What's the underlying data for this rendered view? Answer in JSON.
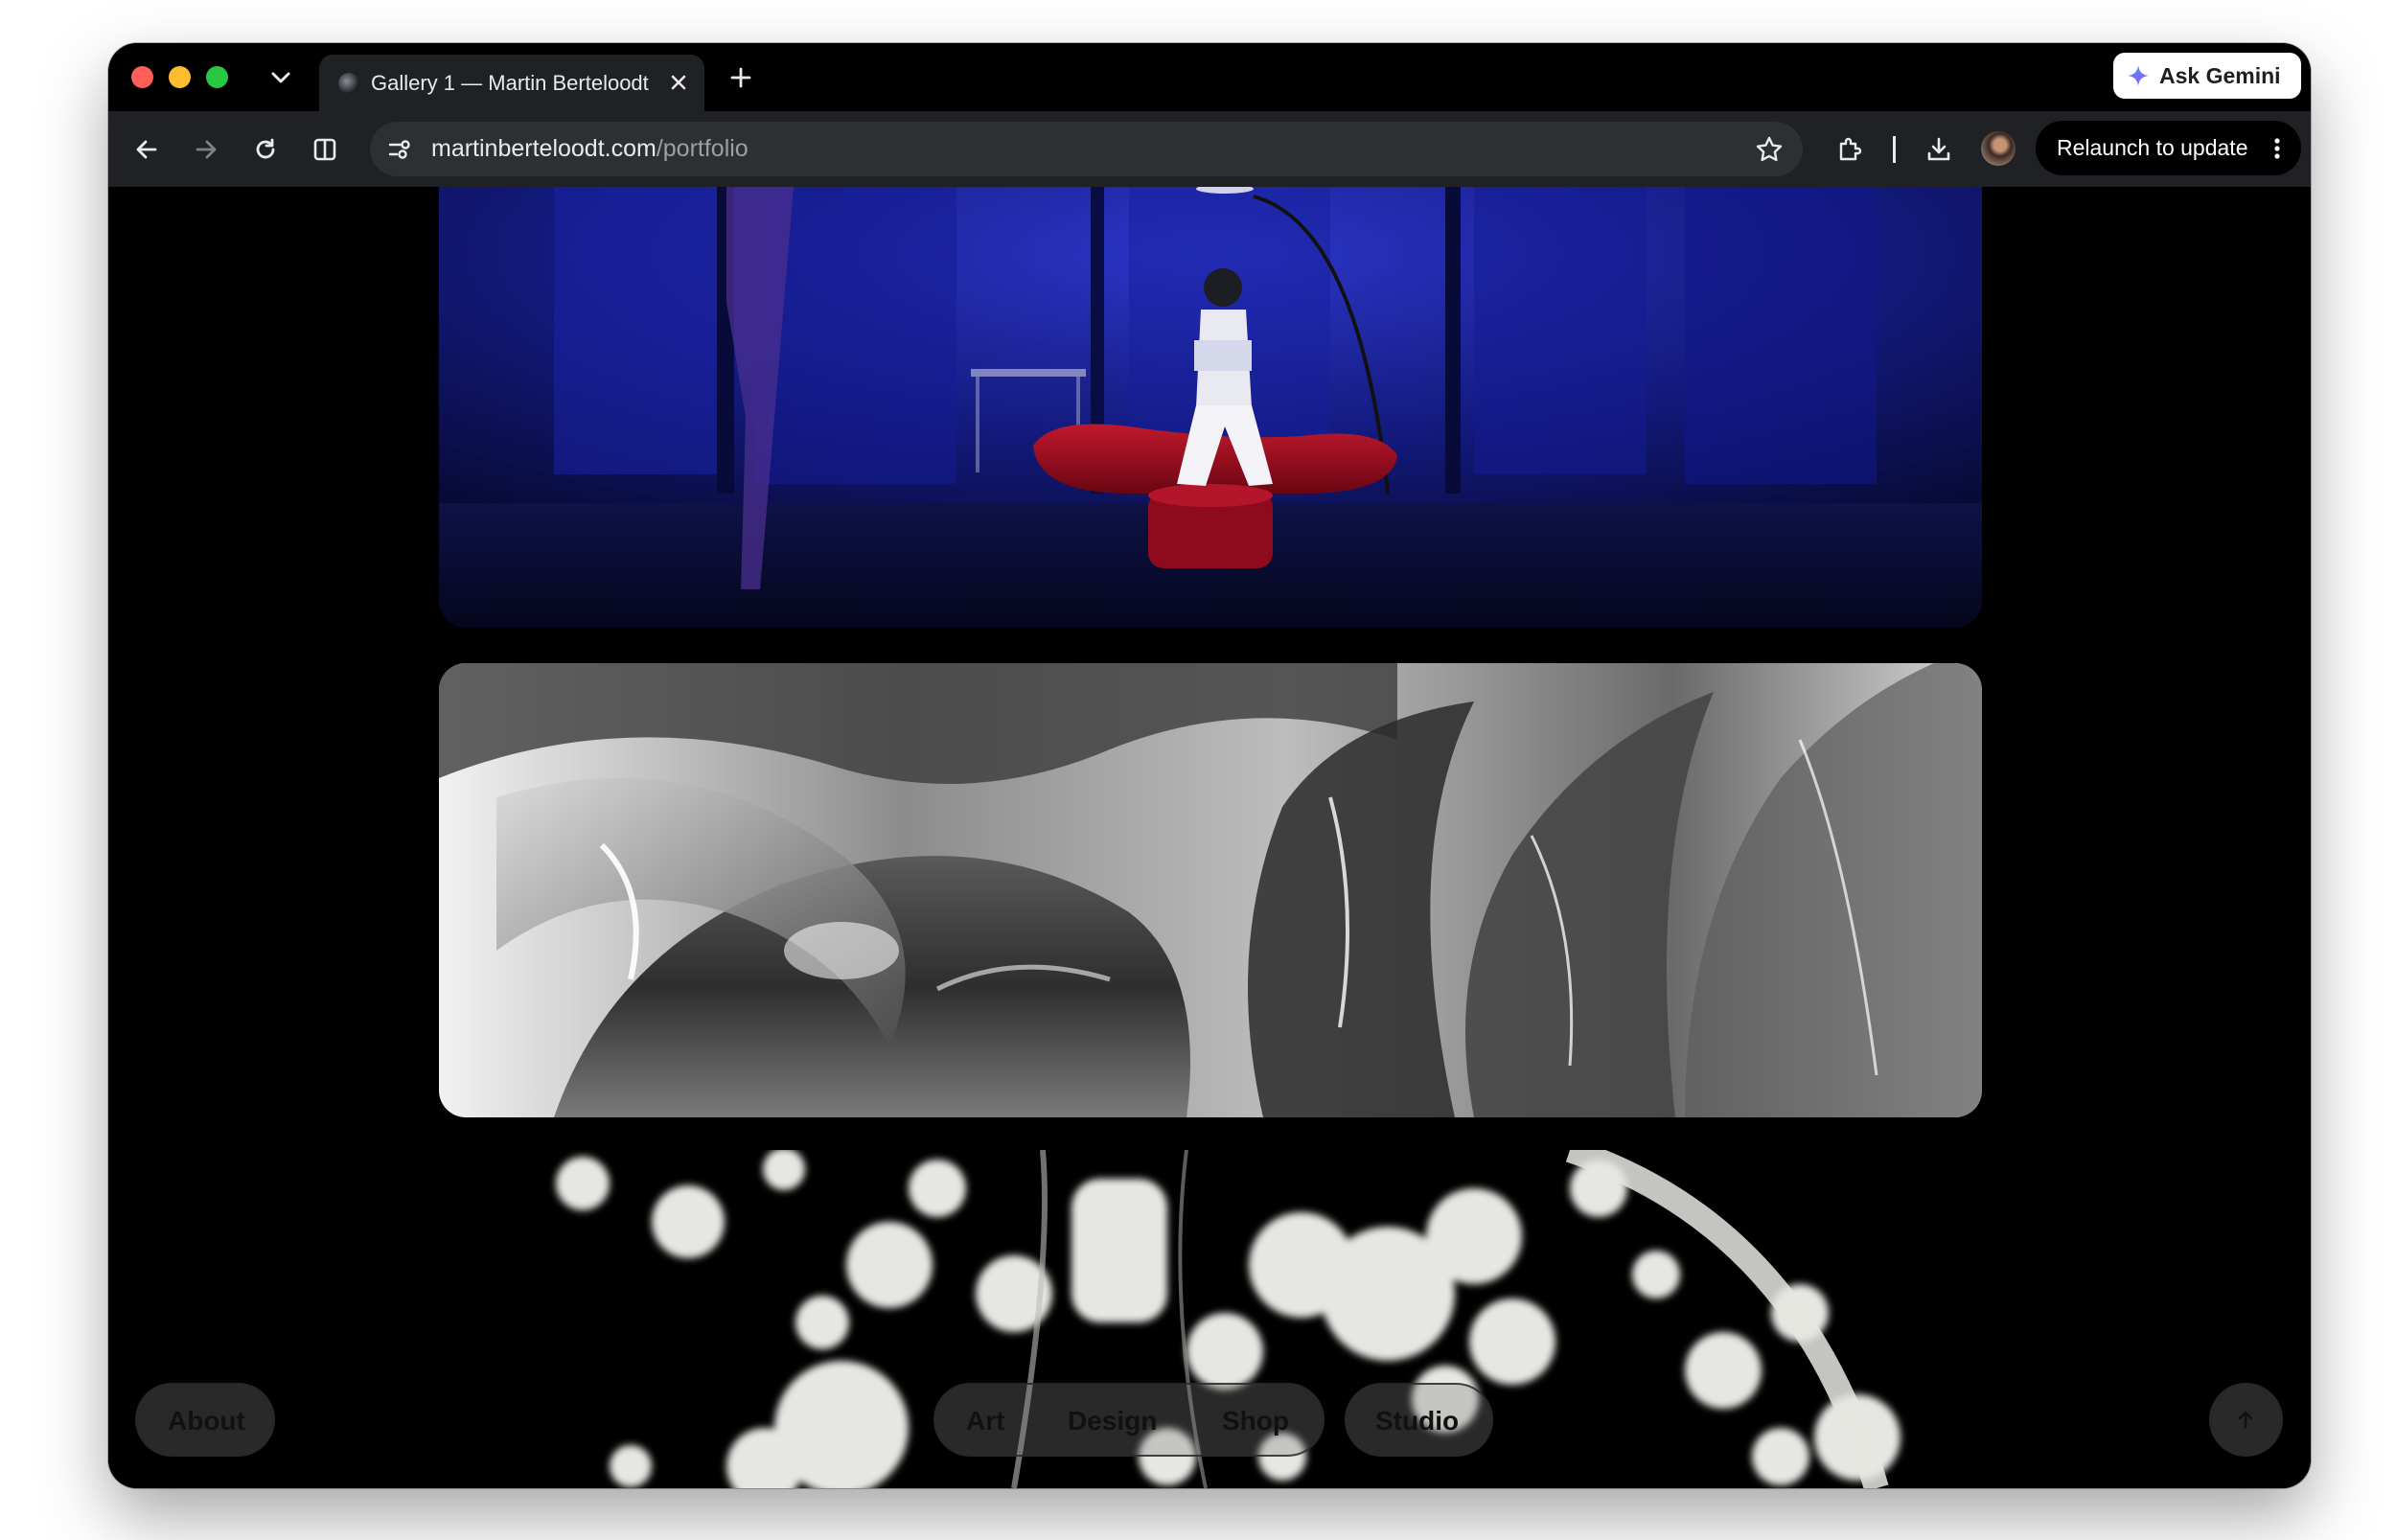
{
  "browser": {
    "tab": {
      "title": "Gallery 1 — Martin Berteloodt"
    },
    "ask_gemini_label": "Ask Gemini",
    "address_bar": {
      "host": "martinberteloodt.com",
      "path": "/portfolio"
    },
    "relaunch_label": "Relaunch to update"
  },
  "site": {
    "nav": {
      "about_label": "About",
      "categories": [
        "Art",
        "Design",
        "Shop"
      ],
      "studio_label": "Studio"
    }
  },
  "colors": {
    "traffic_red": "#ff5f57",
    "traffic_yellow": "#febc2e",
    "traffic_green": "#28c840",
    "toolbar_bg": "#202124",
    "page_bg": "#000000"
  },
  "icons": [
    "chevron-down-icon",
    "close-icon",
    "plus-icon",
    "gemini-spark-icon",
    "back-arrow-icon",
    "forward-arrow-icon",
    "reload-icon",
    "split-view-icon",
    "site-info-icon",
    "star-icon",
    "extensions-icon",
    "download-icon",
    "more-vertical-icon",
    "arrow-up-icon"
  ]
}
